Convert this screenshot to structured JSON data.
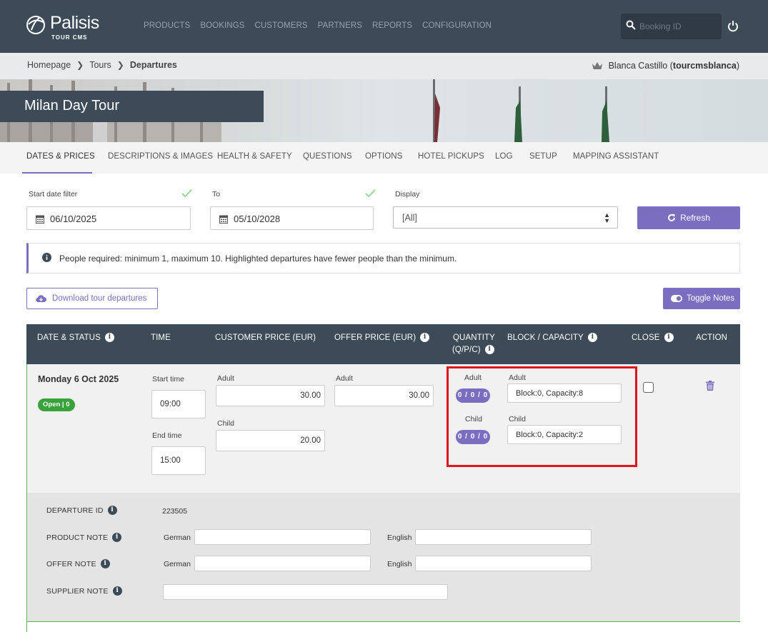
{
  "header": {
    "logo_name": "Palisis",
    "logo_sub": "TOUR CMS",
    "nav": [
      "PRODUCTS",
      "BOOKINGS",
      "CUSTOMERS",
      "PARTNERS",
      "REPORTS",
      "CONFIGURATION"
    ],
    "search_placeholder": "Booking ID"
  },
  "breadcrumb": {
    "items": [
      "Homepage",
      "Tours"
    ],
    "current": "Departures"
  },
  "user": {
    "name": "Blanca Castillo",
    "username": "tourcmsblanca"
  },
  "banner": {
    "title": "Milan Day Tour"
  },
  "tabs": [
    "DATES & PRICES",
    "DESCRIPTIONS & IMAGES",
    "HEALTH & SAFETY",
    "QUESTIONS",
    "OPTIONS",
    "HOTEL PICKUPS",
    "LOG",
    "SETUP",
    "MAPPING ASSISTANT"
  ],
  "filters": {
    "start_label": "Start date filter",
    "start_value": "06/10/2025",
    "to_label": "To",
    "to_value": "05/10/2028",
    "display_label": "Display",
    "display_value": "[All]",
    "refresh_label": "Refresh"
  },
  "info": {
    "text": "People required: minimum 1, maximum 10. Highlighted departures have fewer people than the minimum."
  },
  "buttons": {
    "download": "Download tour departures",
    "toggle_notes": "Toggle Notes"
  },
  "table": {
    "headers": {
      "date_status": "DATE & STATUS",
      "time": "TIME",
      "customer_price": "CUSTOMER PRICE (EUR)",
      "offer_price": "OFFER PRICE (EUR)",
      "quantity_line1": "QUANTITY",
      "quantity_line2": "(Q/P/C)",
      "block_capacity": "BLOCK / CAPACITY",
      "close": "CLOSE",
      "action": "ACTION"
    },
    "row": {
      "date": "Monday 6 Oct 2025",
      "status": "Open | 0",
      "start_time_label": "Start time",
      "start_time": "09:00",
      "end_time_label": "End time",
      "end_time": "15:00",
      "adult_label": "Adult",
      "child_label": "Child",
      "customer_adult": "30.00",
      "customer_child": "20.00",
      "offer_adult": "30.00",
      "qty_adult": "0 / 0 / 0",
      "qty_child": "0 / 0 / 0",
      "cap_adult": "Block:0, Capacity:8",
      "cap_child": "Block:0, Capacity:2"
    }
  },
  "notes": {
    "departure_id_label": "DEPARTURE ID",
    "departure_id": "223505",
    "product_note_label": "PRODUCT NOTE",
    "offer_note_label": "OFFER NOTE",
    "supplier_note_label": "SUPPLIER NOTE",
    "german": "German",
    "english": "English"
  },
  "colors": {
    "header_bg": "#3d4a58",
    "accent": "#7b6dbf",
    "status_open": "#3aa23a",
    "highlight": "#e0141c"
  }
}
